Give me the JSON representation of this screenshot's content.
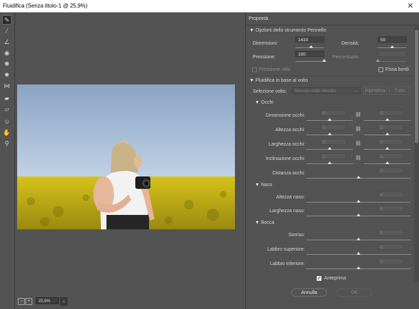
{
  "window": {
    "title": "Fluidifica (Senza titolo-1 @ 25,9%)",
    "close": "✕"
  },
  "tools": [
    {
      "icon": "warp-tool-icon",
      "glyph": "✎"
    },
    {
      "icon": "reconstruct-tool-icon",
      "glyph": "⁄"
    },
    {
      "icon": "smooth-tool-icon",
      "glyph": "∠"
    },
    {
      "icon": "twirl-tool-icon",
      "glyph": "◉"
    },
    {
      "icon": "pucker-tool-icon",
      "glyph": "✺"
    },
    {
      "icon": "bloat-tool-icon",
      "glyph": "✹"
    },
    {
      "icon": "push-left-tool-icon",
      "glyph": "⋈"
    },
    {
      "icon": "freeze-mask-tool-icon",
      "glyph": "▰"
    },
    {
      "icon": "thaw-mask-tool-icon",
      "glyph": "▱"
    },
    {
      "icon": "face-tool-icon",
      "glyph": "☺"
    },
    {
      "icon": "hand-tool-icon",
      "glyph": "✋"
    },
    {
      "icon": "zoom-tool-icon",
      "glyph": "⚲"
    }
  ],
  "status": {
    "zoom": "25,9%"
  },
  "panel": {
    "title": "Proprietà",
    "brush": {
      "header": "Opzioni dello strumento Pennello",
      "size_label": "Dimensioni:",
      "size_value": "1410",
      "size_level": 0.55,
      "density_label": "Densità:",
      "density_value": "50",
      "density_level": 0.5,
      "pressure_label": "Pressione:",
      "pressure_value": "100",
      "pressure_level": 1.0,
      "rate_label": "Percentuale:",
      "rate_value": "",
      "rate_level": 0.0,
      "stylus_label": "Pressione stilo",
      "pin_label": "Fissa bordi"
    },
    "face": {
      "header": "Fluidifica in base al volto",
      "select_label": "Selezione volto:",
      "select_value": "Nessun volto rilevato",
      "reset": "Ripristina",
      "all": "Tutto",
      "eyes": {
        "header": "Occhi",
        "rows": [
          {
            "label": "Dimensione occhi:",
            "left": "0",
            "right": "0",
            "linked": true
          },
          {
            "label": "Altezza occhi:",
            "left": "0",
            "right": "0",
            "linked": true
          },
          {
            "label": "Larghezza occhi:",
            "left": "0",
            "right": "0",
            "linked": true
          },
          {
            "label": "Inclinazione occhi:",
            "left": "0",
            "right": "0",
            "linked": true
          },
          {
            "label": "Distanza occhi:",
            "value": "0"
          }
        ]
      },
      "nose": {
        "header": "Naso",
        "rows": [
          {
            "label": "Altezza naso:",
            "value": "0"
          },
          {
            "label": "Larghezza naso:",
            "value": "0"
          }
        ]
      },
      "mouth": {
        "header": "Bocca",
        "rows": [
          {
            "label": "Sorriso:",
            "value": "0"
          },
          {
            "label": "Labbro superiore:",
            "value": "0"
          },
          {
            "label": "Labbro inferiore:",
            "value": "0"
          }
        ]
      }
    },
    "preview_label": "Anteprima",
    "cancel": "Annulla",
    "ok": "OK"
  }
}
